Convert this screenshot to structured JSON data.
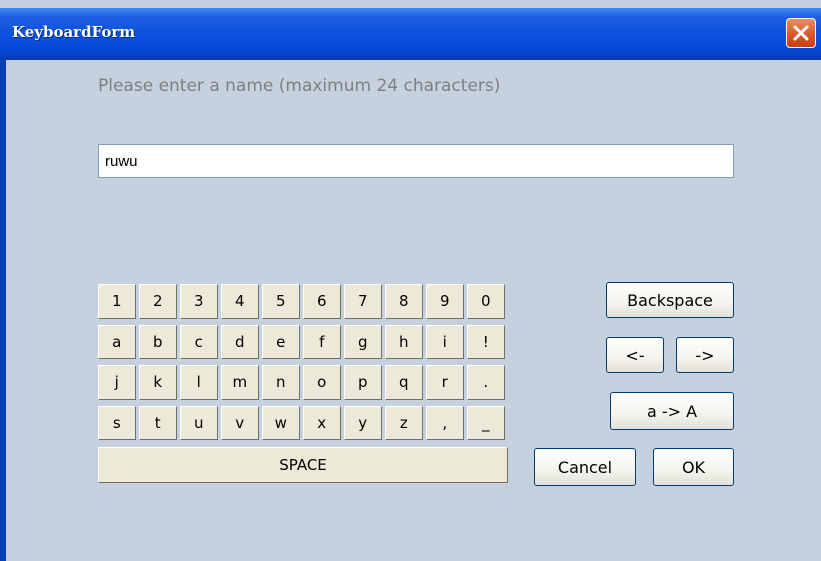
{
  "window": {
    "title": "KeyboardForm"
  },
  "prompt": "Please enter a name (maximum 24 characters)",
  "name_input": {
    "value": "ruwu"
  },
  "keyboard": {
    "rows": [
      [
        "1",
        "2",
        "3",
        "4",
        "5",
        "6",
        "7",
        "8",
        "9",
        "0"
      ],
      [
        "a",
        "b",
        "c",
        "d",
        "e",
        "f",
        "g",
        "h",
        "i",
        "!"
      ],
      [
        "j",
        "k",
        "l",
        "m",
        "n",
        "o",
        "p",
        "q",
        "r",
        "."
      ],
      [
        "s",
        "t",
        "u",
        "v",
        "w",
        "x",
        "y",
        "z",
        ",",
        "_"
      ]
    ],
    "space_label": "SPACE"
  },
  "controls": {
    "backspace_label": "Backspace",
    "left_label": "<-",
    "right_label": "->",
    "shift_label": "a -> A",
    "cancel_label": "Cancel",
    "ok_label": "OK"
  },
  "colors": {
    "title_bar": "#0A50DE",
    "client_background": "#C6D1DF",
    "close_button": "#D9532B",
    "key_face": "#ECE9D8"
  }
}
